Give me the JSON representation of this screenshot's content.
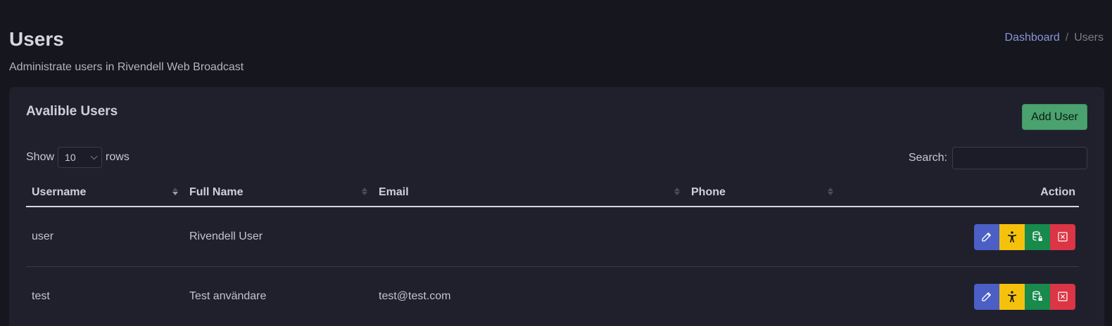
{
  "header": {
    "title": "Users",
    "subtitle": "Administrate users in Rivendell Web Broadcast"
  },
  "breadcrumb": {
    "items": [
      {
        "label": "Dashboard",
        "link": true
      },
      {
        "label": "Users",
        "link": false
      }
    ],
    "separator": "/"
  },
  "card": {
    "title": "Avalible Users",
    "add_button_label": "Add User"
  },
  "table_controls": {
    "show_label": "Show",
    "rows_value": "10",
    "rows_label": "rows",
    "search_label": "Search:",
    "search_value": ""
  },
  "table": {
    "columns": [
      "Username",
      "Full Name",
      "Email",
      "Phone",
      "Action"
    ],
    "sorted_column": "Username",
    "sort_direction": "desc",
    "rows": [
      {
        "username": "user",
        "full_name": "Rivendell User",
        "email": "",
        "phone": ""
      },
      {
        "username": "test",
        "full_name": "Test användare",
        "email": "test@test.com",
        "phone": ""
      }
    ],
    "action_icons": [
      "pencil-icon",
      "accessibility-icon",
      "database-lock-icon",
      "close-box-icon"
    ]
  },
  "colors": {
    "background": "#16161f",
    "card": "#20202d",
    "accent_link": "#8a96d6",
    "add_button": "#4aa26f",
    "edit": "#4b5fc6",
    "access": "#f4c20d",
    "db": "#178a4c",
    "delete": "#dc3545"
  }
}
